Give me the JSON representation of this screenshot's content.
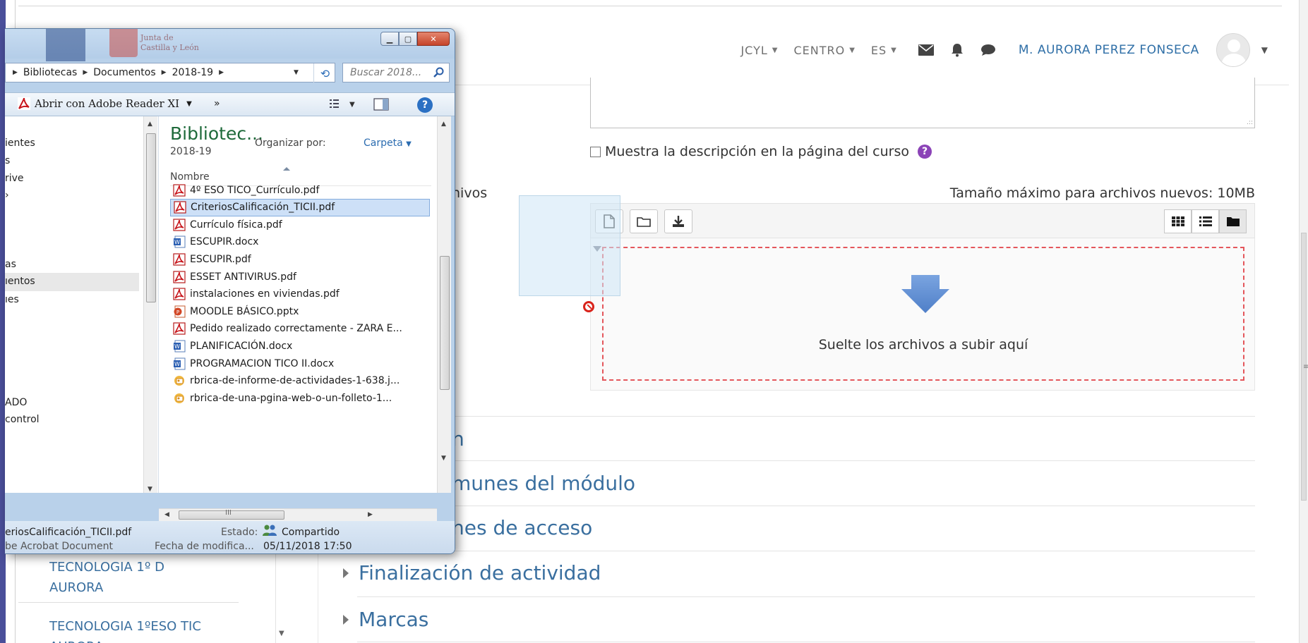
{
  "moodle": {
    "nav": {
      "jcyl": "JCYL",
      "centro": "CENTRO",
      "lang": "ES",
      "user_name": "M. AURORA PEREZ FONSECA"
    },
    "sidebar": {
      "items": [
        {
          "line1": "TECNOLOGIA 1º D",
          "line2": "AURORA"
        },
        {
          "line1": "TECNOLOGIA 1ºESO TIC",
          "line2": "AURORA"
        }
      ]
    },
    "form": {
      "show_description_label": "Muestra la descripción en la página del curso",
      "files_label_fragment": "nivos",
      "max_size": "Tamaño máximo para archivos nuevos: 10MB",
      "drop_text": "Suelte los archivos a subir aquí"
    },
    "sections": {
      "fragment_n": "n",
      "common_fragment": "munes del módulo",
      "access_fragment": "nes de acceso",
      "completion": "Finalización de actividad",
      "tags": "Marcas"
    }
  },
  "explorer": {
    "breadcrumb": [
      "Bibliotecas",
      "Documentos",
      "2018-19"
    ],
    "search_placeholder": "Buscar 2018...",
    "toolbar": {
      "open_with": "Abrir con Adobe Reader XI",
      "more": "»"
    },
    "nav_items": [
      {
        "label": "ientes",
        "top": 0
      },
      {
        "label": "s",
        "top": 0
      },
      {
        "label": "rive",
        "top": 0
      },
      {
        "label": "›",
        "top": 0
      },
      {
        "label": "as",
        "top": 0
      },
      {
        "label": "ıentos",
        "top": 0
      },
      {
        "label": "ıes",
        "top": 0
      },
      {
        "label": "ADO",
        "top": 0
      },
      {
        "label": "control",
        "top": 0
      }
    ],
    "library": {
      "title": "Bibliotec...",
      "subtitle": "2018-19",
      "arrange_label": "Organizar por:",
      "arrange_value": "Carpeta",
      "column_name": "Nombre"
    },
    "files": [
      {
        "name": "4º ESO TICO_Currículo.pdf",
        "type": "pdf"
      },
      {
        "name": "CriteriosCalificación_TICII.pdf",
        "type": "pdf",
        "selected": true
      },
      {
        "name": "Currículo física.pdf",
        "type": "pdf"
      },
      {
        "name": "ESCUPIR.docx",
        "type": "docx"
      },
      {
        "name": "ESCUPIR.pdf",
        "type": "pdf"
      },
      {
        "name": "ESSET ANTIVIRUS.pdf",
        "type": "pdf"
      },
      {
        "name": "instalaciones en viviendas.pdf",
        "type": "pdf"
      },
      {
        "name": "MOODLE BÁSICO.pptx",
        "type": "pptx"
      },
      {
        "name": "Pedido realizado correctamente - ZARA E...",
        "type": "pdf"
      },
      {
        "name": "PLANIFICACIÓN.docx",
        "type": "docx"
      },
      {
        "name": "PROGRAMACION TICO II.docx",
        "type": "docx"
      },
      {
        "name": "rbrica-de-informe-de-actividades-1-638.j...",
        "type": "img"
      },
      {
        "name": "rbrica-de-una-pgina-web-o-un-folleto-1...",
        "type": "img"
      }
    ],
    "details": {
      "file_name": "eriosCalificación_TICII.pdf",
      "file_type": "be Acrobat Document",
      "state_label": "Estado:",
      "state_value": "Compartido",
      "modified_label": "Fecha de modifica...",
      "modified_value": "05/11/2018 17:50"
    },
    "hscroll_mark": "III"
  }
}
